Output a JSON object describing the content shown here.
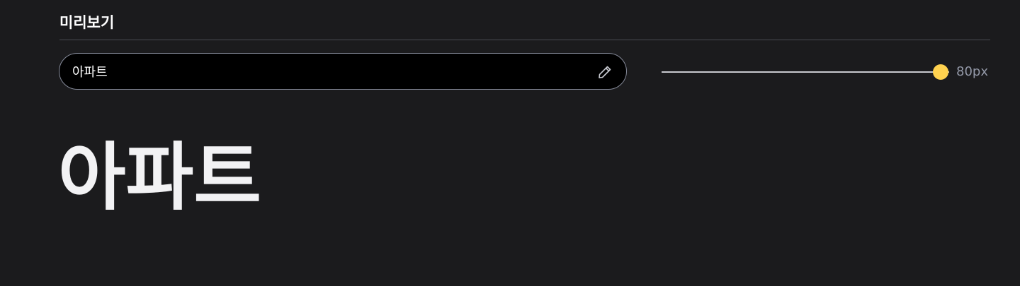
{
  "preview": {
    "title": "미리보기",
    "input_value": "아파트",
    "edit_icon": "pencil-icon",
    "size_label": "80px",
    "size_fraction": 0.97,
    "sample_text": "아파트"
  },
  "colors": {
    "background": "#1b1b1d",
    "accent": "#ffd24f",
    "input_border": "#858a99",
    "muted_text": "#9499a8"
  }
}
